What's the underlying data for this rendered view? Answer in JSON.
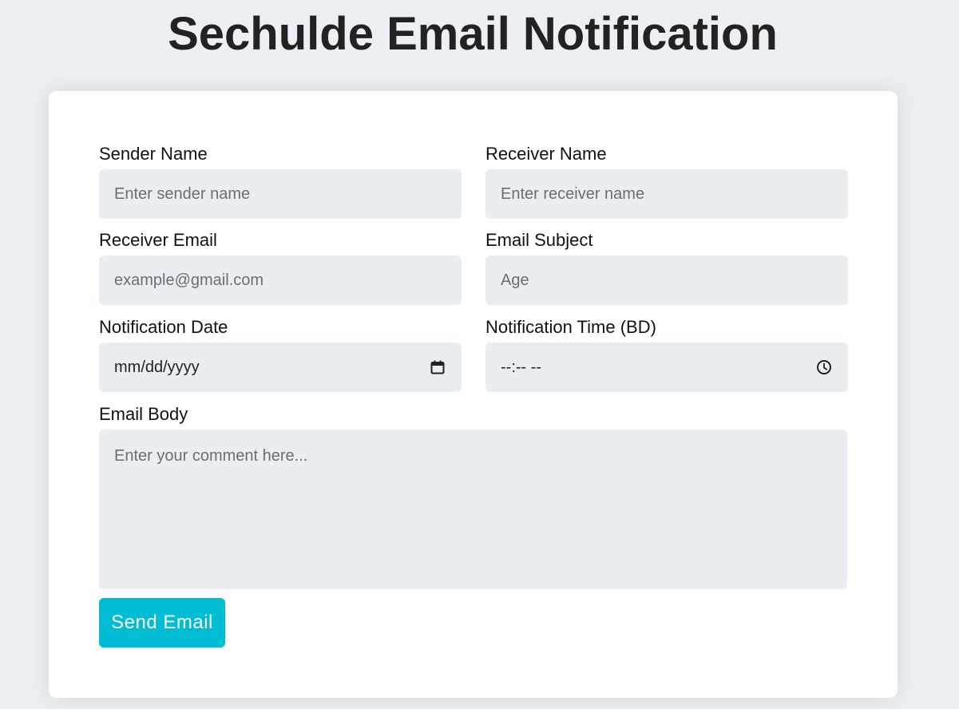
{
  "title": "Sechulde Email Notification",
  "form": {
    "sender_name": {
      "label": "Sender Name",
      "placeholder": "Enter sender name"
    },
    "receiver_name": {
      "label": "Receiver Name",
      "placeholder": "Enter receiver name"
    },
    "receiver_email": {
      "label": "Receiver Email",
      "placeholder": "example@gmail.com"
    },
    "email_subject": {
      "label": "Email Subject",
      "placeholder": "Age"
    },
    "notification_date": {
      "label": "Notification Date",
      "placeholder": "mm/dd/yyyy",
      "icon": "calendar-icon"
    },
    "notification_time": {
      "label": "Notification Time (BD)",
      "placeholder": "--:-- --",
      "icon": "clock-icon"
    },
    "email_body": {
      "label": "Email Body",
      "placeholder": "Enter your comment here..."
    },
    "submit_label": "Send Email"
  },
  "colors": {
    "background": "#eceff3",
    "card": "#ffffff",
    "input": "#eaedf2",
    "accent": "#00bcd4",
    "title": "#222222"
  }
}
